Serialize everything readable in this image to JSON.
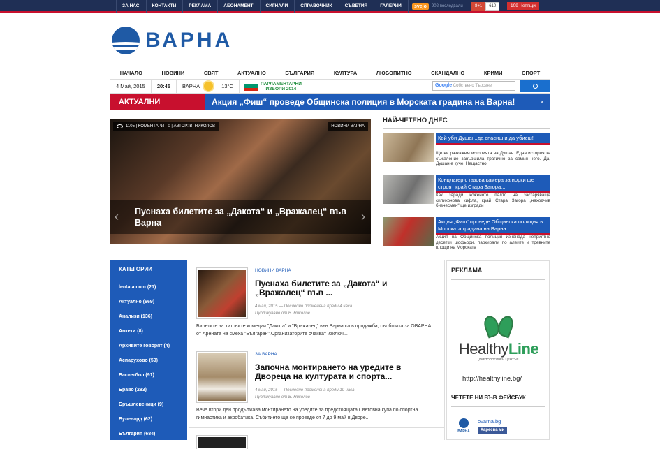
{
  "topnav": [
    "ЗА НАС",
    "КОНТАКТИ",
    "РЕКЛАМА",
    "АБОНАМЕНТ",
    "СИГНАЛИ",
    "СПРАВОЧНИК",
    "СЪВЕТИЯ",
    "ГАЛЕРИИ"
  ],
  "social": {
    "svejo": "svejo",
    "svejo_text": "902 последвали",
    "gplus": "8+1",
    "gplus_count": "610",
    "readers_count": "109",
    "readers_label": "Четящи"
  },
  "logo": {
    "text": "ВАРНА"
  },
  "mainnav": [
    "НАЧАЛО",
    "НОВИНИ",
    "СВЯТ",
    "АКТУАЛНО",
    "БЪЛГАРИЯ",
    "КУЛТУРА",
    "ЛЮБОПИТНО",
    "СКАНДАЛНО",
    "КРИМИ",
    "СПОРТ"
  ],
  "info": {
    "date": "4 Май, 2015",
    "time": "20:45",
    "city": "ВАРНА",
    "temp": "13°C",
    "election_line1": "ПАРЛАМЕНТАРНИ",
    "election_line2": "ИЗБОРИ 2014",
    "search_placeholder": "Собствено Търсене",
    "search_brand": "Google"
  },
  "breaking": {
    "label": "АКТУАЛНИ НОВИНИ",
    "text": "Акция „Фиш“ проведе Общинска полиция в Морската градина на Варна!",
    "close": "×"
  },
  "slider": {
    "meta": "1105 | КОМЕНТАРИ - 0 | АВТОР: В. НИКОЛОВ",
    "category": "НОВИНИ ВАРНА",
    "caption": "Пуснаха билетите за „Дакота“ и „Вражалец“ във Варна",
    "prev": "‹",
    "next": "›"
  },
  "mostread": {
    "title": "НАЙ-ЧЕТЕНО ДНЕС",
    "items": [
      {
        "title": "Кой уби Душан..да спасиш и да убиеш!",
        "excerpt": "Ще ви разкажем историята на Душан. Една история за съжаление завършила трагично за самия него. Да, Душан е куче. Нещастно,",
        "color": "#b9a588"
      },
      {
        "title": "Концлагер с газова камера за норки ще строят край Стара Загора...",
        "excerpt": "Как заради коженото палто на застаряваща силиконова кифла, край Стара Загора „находчив бизнесмен“ ще изгради",
        "color": "#8a8a86"
      },
      {
        "title": "Акция „Фиш“ проведе Общинска полиция в Морската градина на Варна...",
        "excerpt": "Акция на Общинска полиция изненада неприятно десетки шофьори, паркирали по алеите и тревните площи на Морската",
        "color": "#6a7a5a"
      }
    ]
  },
  "categories": {
    "title": "КАТЕГОРИИ",
    "items": [
      "lentata.com (21)",
      "Актуално (669)",
      "Анализи (136)",
      "Анкети (8)",
      "Архивите говорят (4)",
      "Аспарухово (59)",
      "Баскетбол (91)",
      "Браво (283)",
      "Бръшлевеници (9)",
      "Булевард (62)",
      "България (684)"
    ]
  },
  "feed": [
    {
      "category": "НОВИНИ ВАРНА",
      "title": "Пуснаха билетите за „Дакота“ и „Вражалец“ във ...",
      "date": "4 май, 2015 — Последно променена преди 4 часа",
      "author": "Публикувано от В. Николов",
      "excerpt": "Билетите за хитовите комедии \"Дакота\" и \"Вражалец\" във Варна са в продажба, съобщиха за ОВАРНА от Арената на смеха \"Българан\".Организаторите очакват изключ...",
      "color": "#6a4a2f"
    },
    {
      "category": "ЗА ВАРНА",
      "title": "Започна монтирането на уредите в Двореца на културата и спорта...",
      "date": "4 май, 2015 — Последно променена преди 10 часа",
      "author": "Публикувано от В. Николов",
      "excerpt": "Вече втори ден продължава монтирането на уредите за предстоящата Световна купа по спортна гимнастика и акробатика. Събитието ще се проведе от 7 до 9 май в Дворе...",
      "color": "#a58c6a"
    }
  ],
  "ad": {
    "title": "РЕКЛАМА",
    "brand_a": "Healthy",
    "brand_b": "Line",
    "brand_sub": "ДИЕТОЛОГИЧЕН ЦЕНТЪР",
    "url": "http://healthyline.bg/"
  },
  "facebook": {
    "title": "ЧЕТЕТЕ НИ ВЪВ ФЕЙСБУК",
    "page": "ovarna.bg",
    "logo": "ВАРНА",
    "like": "Харесва ми"
  },
  "colors": {
    "accent": "#1e5bb8",
    "red": "#c8102e",
    "topbar": "#1f2f55"
  }
}
